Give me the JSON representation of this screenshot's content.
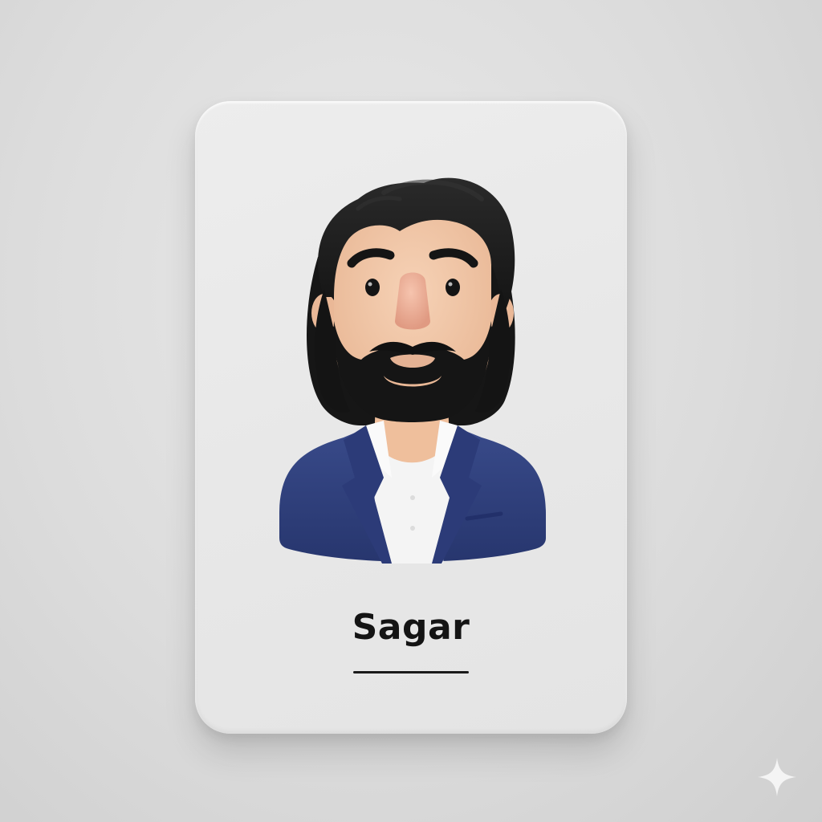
{
  "profile_card": {
    "name": "Sagar",
    "avatar_icon": "person-avatar-icon"
  },
  "colors": {
    "background": "#dcdcdc",
    "card": "#ebebeb",
    "hair": "#1c1c1c",
    "skin": "#f0c8a8",
    "jacket": "#2f3f7e",
    "shirt": "#f5f5f5",
    "text": "#141414"
  },
  "watermark": {
    "icon": "sparkle-icon"
  }
}
